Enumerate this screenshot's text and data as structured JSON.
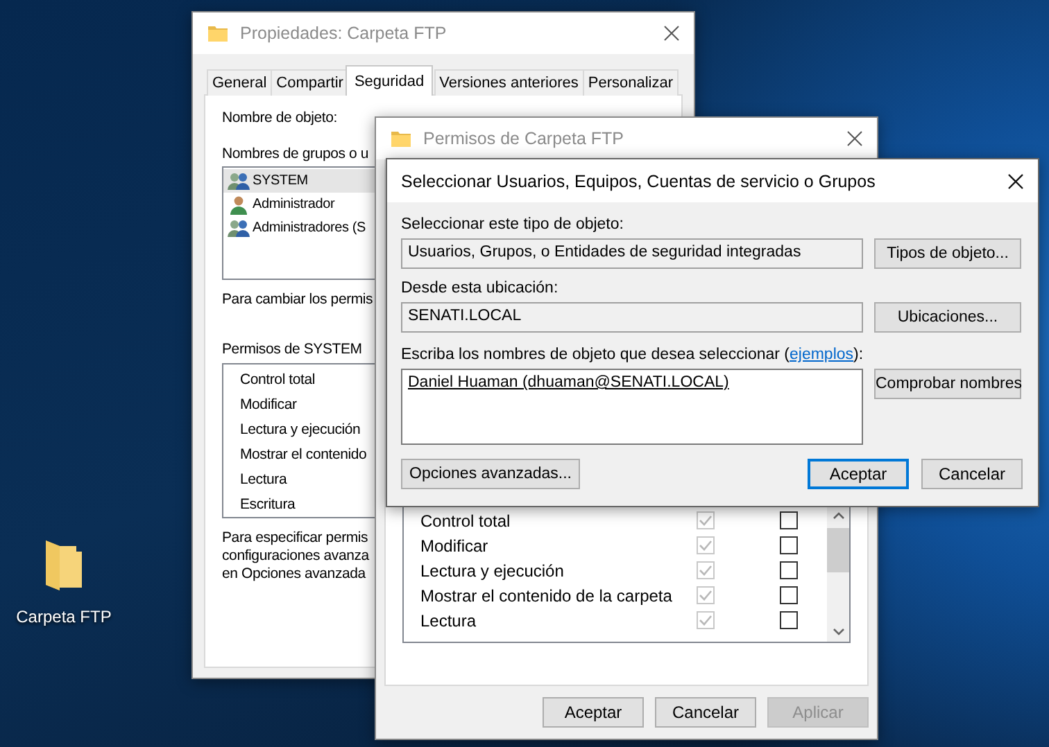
{
  "desktop": {
    "icons": [
      {
        "label": "Carpeta FTP"
      }
    ]
  },
  "properties_window": {
    "title": "Propiedades: Carpeta FTP",
    "tabs": [
      {
        "label": "General",
        "selected": false
      },
      {
        "label": "Compartir",
        "selected": false
      },
      {
        "label": "Seguridad",
        "selected": true
      },
      {
        "label": "Versiones anteriores",
        "selected": false
      },
      {
        "label": "Personalizar",
        "selected": false
      }
    ],
    "object_name_label": "Nombre de objeto:",
    "groups_label": "Nombres de grupos o u",
    "users": [
      {
        "name": "SYSTEM",
        "kind": "group",
        "selected": true
      },
      {
        "name": "Administrador",
        "kind": "user",
        "selected": false
      },
      {
        "name": "Administradores (S",
        "kind": "group",
        "selected": false
      }
    ],
    "change_hint": "Para cambiar los permis",
    "permissions_label": "Permisos de SYSTEM",
    "permissions": [
      "Control total",
      "Modificar",
      "Lectura y ejecución",
      "Mostrar el contenido",
      "Lectura",
      "Escritura"
    ],
    "advanced_hint": [
      "Para especificar permis",
      "configuraciones avanza",
      "en Opciones avanzada"
    ]
  },
  "permissions_window": {
    "title": "Permisos de Carpeta FTP",
    "permissions": [
      {
        "name": "Control total",
        "allow": {
          "checked": true,
          "disabled": true
        },
        "deny": {
          "checked": false,
          "disabled": false
        }
      },
      {
        "name": "Modificar",
        "allow": {
          "checked": true,
          "disabled": true
        },
        "deny": {
          "checked": false,
          "disabled": false
        }
      },
      {
        "name": "Lectura y ejecución",
        "allow": {
          "checked": true,
          "disabled": true
        },
        "deny": {
          "checked": false,
          "disabled": false
        }
      },
      {
        "name": "Mostrar el contenido de la carpeta",
        "allow": {
          "checked": true,
          "disabled": true
        },
        "deny": {
          "checked": false,
          "disabled": false
        }
      },
      {
        "name": "Lectura",
        "allow": {
          "checked": true,
          "disabled": true
        },
        "deny": {
          "checked": false,
          "disabled": false
        }
      }
    ],
    "buttons": [
      {
        "label": "Aceptar",
        "disabled": false
      },
      {
        "label": "Cancelar",
        "disabled": false
      },
      {
        "label": "Aplicar",
        "disabled": true
      }
    ]
  },
  "select_dialog": {
    "title": "Seleccionar Usuarios, Equipos, Cuentas de servicio o Grupos",
    "object_type_label": "Seleccionar este tipo de objeto:",
    "object_type_value": "Usuarios, Grupos, o Entidades de seguridad integradas",
    "object_type_button": "Tipos de objeto...",
    "location_label": "Desde esta ubicación:",
    "location_value": "SENATI.LOCAL",
    "location_button": "Ubicaciones...",
    "names_label_before": "Escriba los nombres de objeto que desea seleccionar (",
    "names_link": "ejemplos",
    "names_label_after": "):",
    "names_value": "Daniel Huaman (dhuaman@SENATI.LOCAL)",
    "check_button": "Comprobar nombres",
    "advanced_button": "Opciones avanzadas...",
    "buttons": [
      {
        "label": "Aceptar",
        "default": true
      },
      {
        "label": "Cancelar",
        "default": false
      }
    ]
  }
}
